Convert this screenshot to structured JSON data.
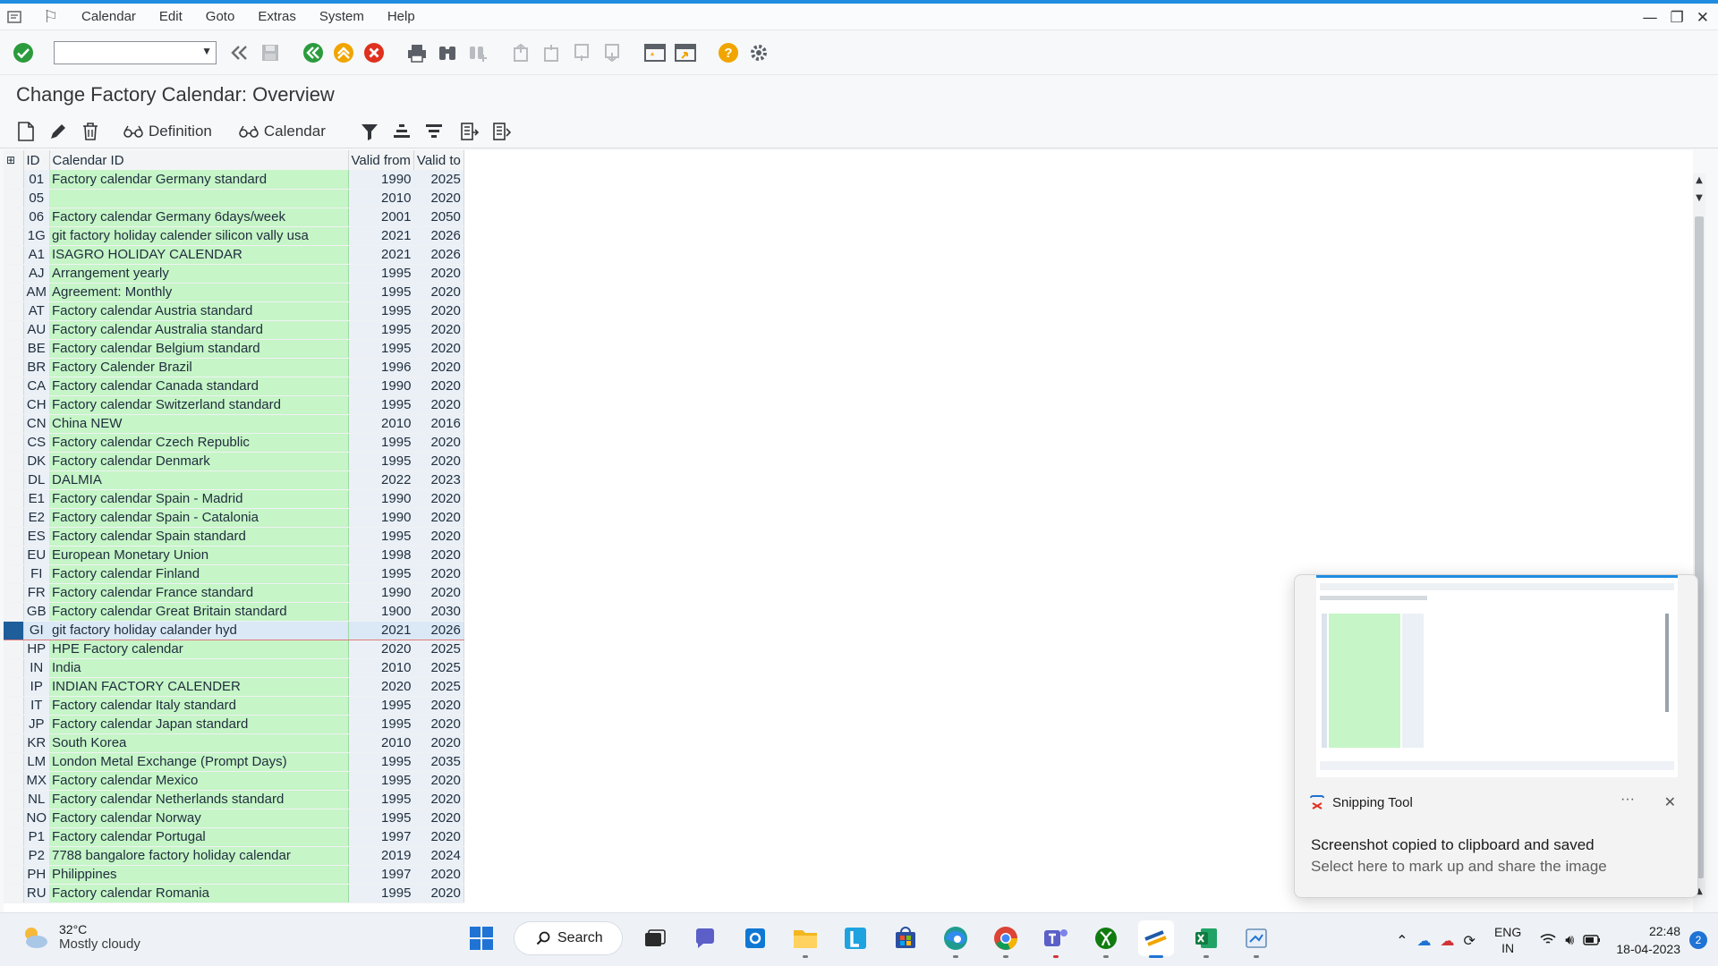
{
  "menubar": {
    "items": [
      "Calendar",
      "Edit",
      "Goto",
      "Extras",
      "System",
      "Help"
    ]
  },
  "title": "Change Factory Calendar: Overview",
  "app_toolbar": {
    "definition_label": "Definition",
    "calendar_label": "Calendar"
  },
  "table": {
    "headers": {
      "id": "ID",
      "name": "Calendar ID",
      "from": "Valid from",
      "to": "Valid to"
    },
    "rows": [
      {
        "id": "01",
        "name": "Factory calendar Germany standard",
        "from": "1990",
        "to": "2025"
      },
      {
        "id": "05",
        "name": "",
        "from": "2010",
        "to": "2020"
      },
      {
        "id": "06",
        "name": "Factory calendar Germany 6days/week",
        "from": "2001",
        "to": "2050"
      },
      {
        "id": "1G",
        "name": "git factory holiday calender silicon vally usa",
        "from": "2021",
        "to": "2026"
      },
      {
        "id": "A1",
        "name": "ISAGRO HOLIDAY CALENDAR",
        "from": "2021",
        "to": "2026"
      },
      {
        "id": "AJ",
        "name": "Arrangement yearly",
        "from": "1995",
        "to": "2020"
      },
      {
        "id": "AM",
        "name": "Agreement: Monthly",
        "from": "1995",
        "to": "2020"
      },
      {
        "id": "AT",
        "name": "Factory calendar Austria standard",
        "from": "1995",
        "to": "2020"
      },
      {
        "id": "AU",
        "name": "Factory calendar Australia standard",
        "from": "1995",
        "to": "2020"
      },
      {
        "id": "BE",
        "name": "Factory calendar Belgium standard",
        "from": "1995",
        "to": "2020"
      },
      {
        "id": "BR",
        "name": "Factory Calender Brazil",
        "from": "1996",
        "to": "2020"
      },
      {
        "id": "CA",
        "name": "Factory calendar Canada standard",
        "from": "1990",
        "to": "2020"
      },
      {
        "id": "CH",
        "name": "Factory calendar Switzerland standard",
        "from": "1995",
        "to": "2020"
      },
      {
        "id": "CN",
        "name": "China NEW",
        "from": "2010",
        "to": "2016"
      },
      {
        "id": "CS",
        "name": "Factory calendar Czech Republic",
        "from": "1995",
        "to": "2020"
      },
      {
        "id": "DK",
        "name": "Factory calendar Denmark",
        "from": "1995",
        "to": "2020"
      },
      {
        "id": "DL",
        "name": "DALMIA",
        "from": "2022",
        "to": "2023"
      },
      {
        "id": "E1",
        "name": "Factory calendar Spain - Madrid",
        "from": "1990",
        "to": "2020"
      },
      {
        "id": "E2",
        "name": "Factory calendar Spain - Catalonia",
        "from": "1990",
        "to": "2020"
      },
      {
        "id": "ES",
        "name": "Factory calendar Spain standard",
        "from": "1995",
        "to": "2020"
      },
      {
        "id": "EU",
        "name": "European Monetary Union",
        "from": "1998",
        "to": "2020"
      },
      {
        "id": "FI",
        "name": "Factory calendar Finland",
        "from": "1995",
        "to": "2020"
      },
      {
        "id": "FR",
        "name": "Factory calendar France standard",
        "from": "1990",
        "to": "2020"
      },
      {
        "id": "GB",
        "name": "Factory calendar Great Britain standard",
        "from": "1900",
        "to": "2030"
      },
      {
        "id": "GI",
        "name": "git factory holiday calander hyd",
        "from": "2021",
        "to": "2026",
        "selected": true
      },
      {
        "id": "HP",
        "name": "HPE Factory calendar",
        "from": "2020",
        "to": "2025"
      },
      {
        "id": "IN",
        "name": "India",
        "from": "2010",
        "to": "2025"
      },
      {
        "id": "IP",
        "name": "INDIAN FACTORY CALENDER",
        "from": "2020",
        "to": "2025"
      },
      {
        "id": "IT",
        "name": "Factory calendar Italy standard",
        "from": "1995",
        "to": "2020"
      },
      {
        "id": "JP",
        "name": "Factory calendar Japan standard",
        "from": "1995",
        "to": "2020"
      },
      {
        "id": "KR",
        "name": "South Korea",
        "from": "2010",
        "to": "2020"
      },
      {
        "id": "LM",
        "name": "London Metal Exchange (Prompt Days)",
        "from": "1995",
        "to": "2035"
      },
      {
        "id": "MX",
        "name": "Factory calendar Mexico",
        "from": "1995",
        "to": "2020"
      },
      {
        "id": "NL",
        "name": "Factory calendar Netherlands standard",
        "from": "1995",
        "to": "2020"
      },
      {
        "id": "NO",
        "name": "Factory calendar Norway",
        "from": "1995",
        "to": "2020"
      },
      {
        "id": "P1",
        "name": "Factory calendar Portugal",
        "from": "1997",
        "to": "2020"
      },
      {
        "id": "P2",
        "name": "7788 bangalore factory holiday calendar",
        "from": "2019",
        "to": "2024"
      },
      {
        "id": "PH",
        "name": "Philippines",
        "from": "1997",
        "to": "2020"
      },
      {
        "id": "RU",
        "name": "Factory calendar Romania",
        "from": "1995",
        "to": "2020"
      }
    ]
  },
  "notification": {
    "app_name": "Snipping Tool",
    "more": "···",
    "message": "Screenshot copied to clipboard and saved",
    "sub_message": "Select here to mark up and share the image"
  },
  "taskbar": {
    "weather_temp": "32°C",
    "weather_cond": "Mostly cloudy",
    "search_label": "Search",
    "lang_top": "ENG",
    "lang_bottom": "IN",
    "time": "22:48",
    "date": "18-04-2023",
    "notif_count": "2"
  },
  "colors": {
    "accent": "#1f8ce0",
    "name_column": "#c6f5c7",
    "id_column": "#eaf0f6",
    "selected_marker": "#1d5e9b"
  }
}
